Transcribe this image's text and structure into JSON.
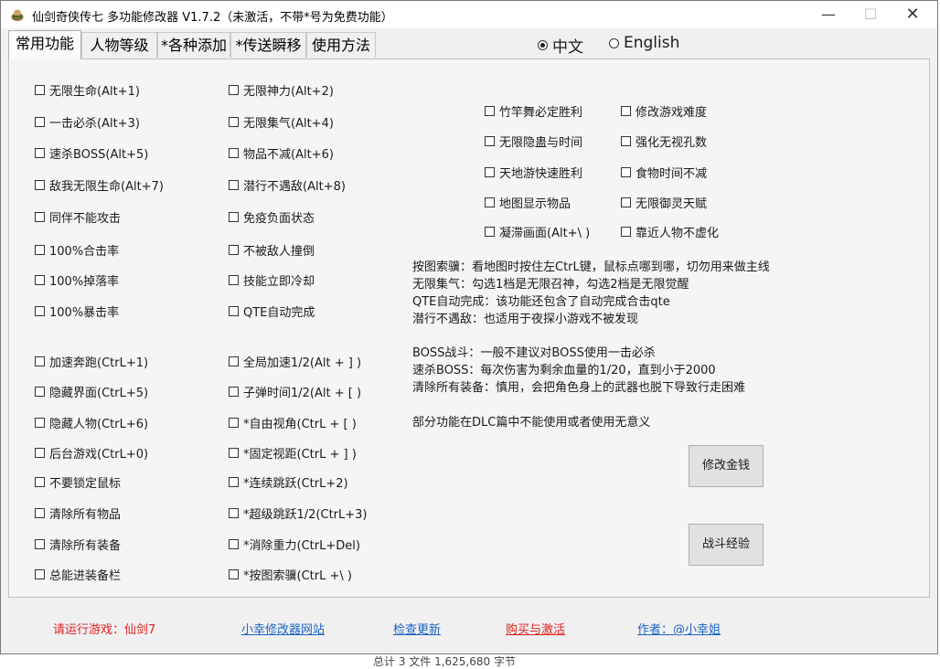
{
  "window": {
    "title": "仙剑奇侠传七 多功能修改器  V1.7.2（未激活，不带*号为免费功能）",
    "min_glyph": "—",
    "max_glyph": "☐",
    "close_glyph": "✕"
  },
  "tabs": [
    {
      "label": "常用功能",
      "active": true
    },
    {
      "label": "人物等级",
      "active": false
    },
    {
      "label": "*各种添加",
      "active": false
    },
    {
      "label": "*传送瞬移",
      "active": false
    },
    {
      "label": "使用方法",
      "active": false
    }
  ],
  "language": {
    "options": [
      {
        "label": "中文",
        "selected": true
      },
      {
        "label": "English",
        "selected": false
      }
    ]
  },
  "options": {
    "col1": [
      "无限生命(Alt+1)",
      "一击必杀(Alt+3)",
      "速杀BOSS(Alt+5)",
      "敌我无限生命(Alt+7)",
      "同伴不能攻击",
      "100%合击率",
      "100%掉落率",
      "100%暴击率"
    ],
    "col2": [
      "无限神力(Alt+2)",
      "无限集气(Alt+4)",
      "物品不减(Alt+6)",
      "潜行不遇敌(Alt+8)",
      "免疫负面状态",
      "不被敌人撞倒",
      "技能立即冷却",
      "QTE自动完成"
    ],
    "col3": [
      "加速奔跑(CtrL+1)",
      "隐藏界面(CtrL+5)",
      "隐藏人物(CtrL+6)",
      "后台游戏(CtrL+0)",
      "不要锁定鼠标",
      "清除所有物品",
      "清除所有装备",
      "总能进装备栏"
    ],
    "col4": [
      "全局加速1/2(Alt + ] )",
      "子弹时间1/2(Alt + [ )",
      "*自由视角(CtrL + [ )",
      "*固定视距(CtrL + ] )",
      "*连续跳跃(CtrL+2)",
      "*超级跳跃1/2(CtrL+3)",
      "*消除重力(CtrL+Del)",
      "*按图索骥(CtrL +\\ )"
    ],
    "col5": [
      "竹竿舞必定胜利",
      "无限隐蛊与时间",
      "天地游快速胜利",
      "地图显示物品",
      "凝滞画面(Alt+\\ )"
    ],
    "col6": [
      "修改游戏难度",
      "强化无视孔数",
      "食物时间不减",
      "无限御灵天赋",
      "靠近人物不虚化"
    ]
  },
  "notes": {
    "group1": [
      "按图索骥：看地图时按住左CtrL键，鼠标点哪到哪，切勿用来做主线",
      "无限集气：勾选1档是无限召神，勾选2档是无限觉醒",
      "QTE自动完成：该功能还包含了自动完成合击qte",
      "潜行不遇敌：也适用于夜探小游戏不被发现"
    ],
    "group2": [
      "BOSS战斗：一般不建议对BOSS使用一击必杀",
      "速杀BOSS：每次伤害为剩余血量的1/20，直到小于2000",
      "清除所有装备：慎用，会把角色身上的武器也脱下导致行走困难"
    ],
    "group3": [
      "部分功能在DLC篇中不能使用或者使用无意义"
    ]
  },
  "buttons": {
    "money": "修改金钱",
    "exp": "战斗经验"
  },
  "footer": {
    "status": "请运行游戏：仙剑7",
    "site": "小幸修改器网站",
    "update": "检查更新",
    "buy": "购买与激活",
    "author": "作者：@小幸姐"
  },
  "background": {
    "bottom_text": "总计 3 文件 1,625,680 字节"
  },
  "colors": {
    "status": "#e0201f",
    "link": "#1b63c6"
  }
}
